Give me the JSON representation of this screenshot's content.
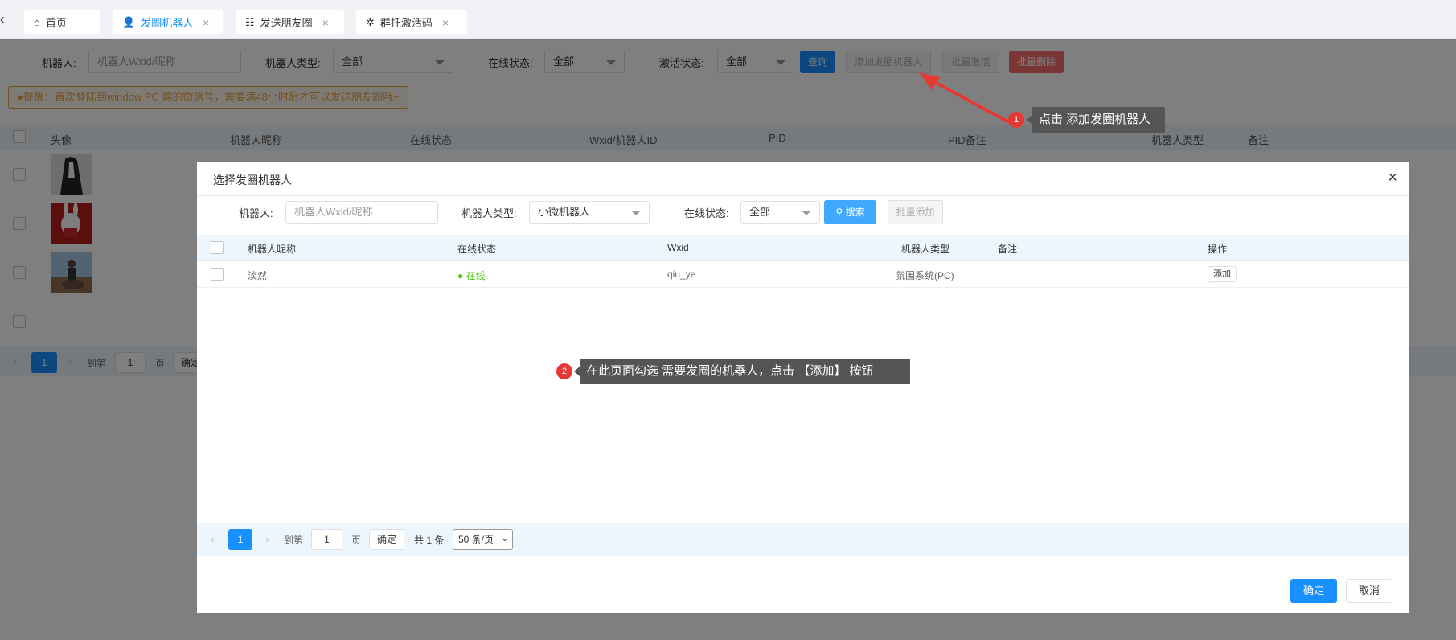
{
  "tabs": [
    {
      "icon": "home-icon",
      "label": "首页"
    },
    {
      "icon": "user-icon",
      "label": "发圈机器人"
    },
    {
      "icon": "list-icon",
      "label": "发送朋友圈"
    },
    {
      "icon": "palm-icon",
      "label": "群托激活码"
    }
  ],
  "filters": {
    "robot_label": "机器人:",
    "robot_placeholder": "机器人Wxid/昵称",
    "type_label": "机器人类型:",
    "type_value": "全部",
    "online_label": "在线状态:",
    "online_value": "全部",
    "activate_label": "激活状态:",
    "activate_value": "全部",
    "query_button": "查询",
    "add_button": "添加发圈机器人",
    "batch_activate_button": "批量激活",
    "batch_delete_button": "批量删除"
  },
  "notice": "●提醒：首次登陆到window PC 端的微信号，需要满48小时后才可以发送朋友圈哦~",
  "main_table": {
    "headers": [
      "头像",
      "机器人昵称",
      "在线状态",
      "Wxid/机器人ID",
      "PID",
      "PID备注",
      "机器人类型",
      "备注"
    ]
  },
  "main_pager": {
    "page": "1",
    "goto_label": "到第",
    "goto_value": "1",
    "page_unit": "页",
    "confirm": "确定"
  },
  "modal": {
    "title": "选择发圈机器人",
    "close": "×",
    "robot_label": "机器人:",
    "robot_placeholder": "机器人Wxid/昵称",
    "type_label": "机器人类型:",
    "type_value": "小微机器人",
    "online_label": "在线状态:",
    "online_value": "全部",
    "search_button": "搜索",
    "batch_add_button": "批量添加",
    "headers": [
      "机器人昵称",
      "在线状态",
      "Wxid",
      "机器人类型",
      "备注",
      "操作"
    ],
    "rows": [
      {
        "nickname": "淡然",
        "status": "● 在线",
        "wxid": "qiu_ye",
        "type": "氛围系统(PC)",
        "note": "",
        "action": "添加"
      }
    ],
    "pager": {
      "page": "1",
      "goto_label": "到第",
      "goto_value": "1",
      "page_unit": "页",
      "confirm": "确定",
      "total": "共 1 条",
      "page_size": "50 条/页"
    },
    "ok_button": "确定",
    "cancel_button": "取消"
  },
  "annotations": [
    {
      "number": "1",
      "text": "点击 添加发圈机器人"
    },
    {
      "number": "2",
      "text": "在此页面勾选  需要发圈的机器人，点击 【添加】 按钮"
    }
  ],
  "colors": {
    "primary": "#1890ff",
    "danger": "#f56c6c",
    "warning": "#e6a23c",
    "online": "#52c41a",
    "annotation_red": "#e53935"
  }
}
